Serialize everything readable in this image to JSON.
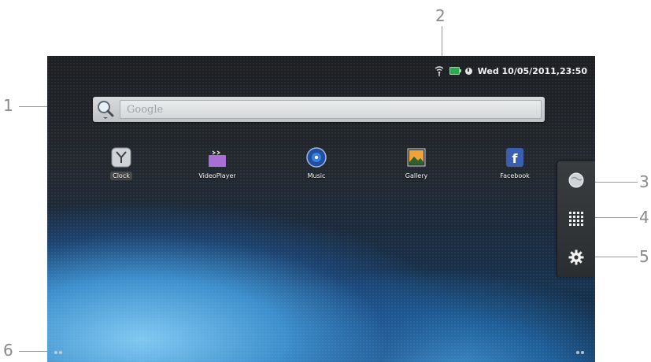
{
  "callouts": [
    "1",
    "2",
    "3",
    "4",
    "5",
    "6"
  ],
  "status_bar": {
    "datetime": "Wed 10/05/2011,23:50",
    "icons": [
      "wifi-icon",
      "battery-icon",
      "alarm-icon"
    ]
  },
  "search": {
    "placeholder": "Google",
    "button_icon": "search-icon"
  },
  "apps": [
    {
      "label": "Clock",
      "icon": "clock-icon"
    },
    {
      "label": "VideoPlayer",
      "icon": "video-player-icon"
    },
    {
      "label": "Music",
      "icon": "music-icon"
    },
    {
      "label": "Gallery",
      "icon": "gallery-icon"
    },
    {
      "label": "Facebook",
      "icon": "facebook-icon"
    }
  ],
  "sidebar": {
    "buttons": [
      "browser-globe-icon",
      "app-drawer-grid-icon",
      "settings-gear-icon"
    ]
  },
  "colors": {
    "status_text": "#f2f2f2",
    "battery": "#2fa84f",
    "search_bar": "#d8dadc",
    "sidebar": "#3a3d40"
  }
}
